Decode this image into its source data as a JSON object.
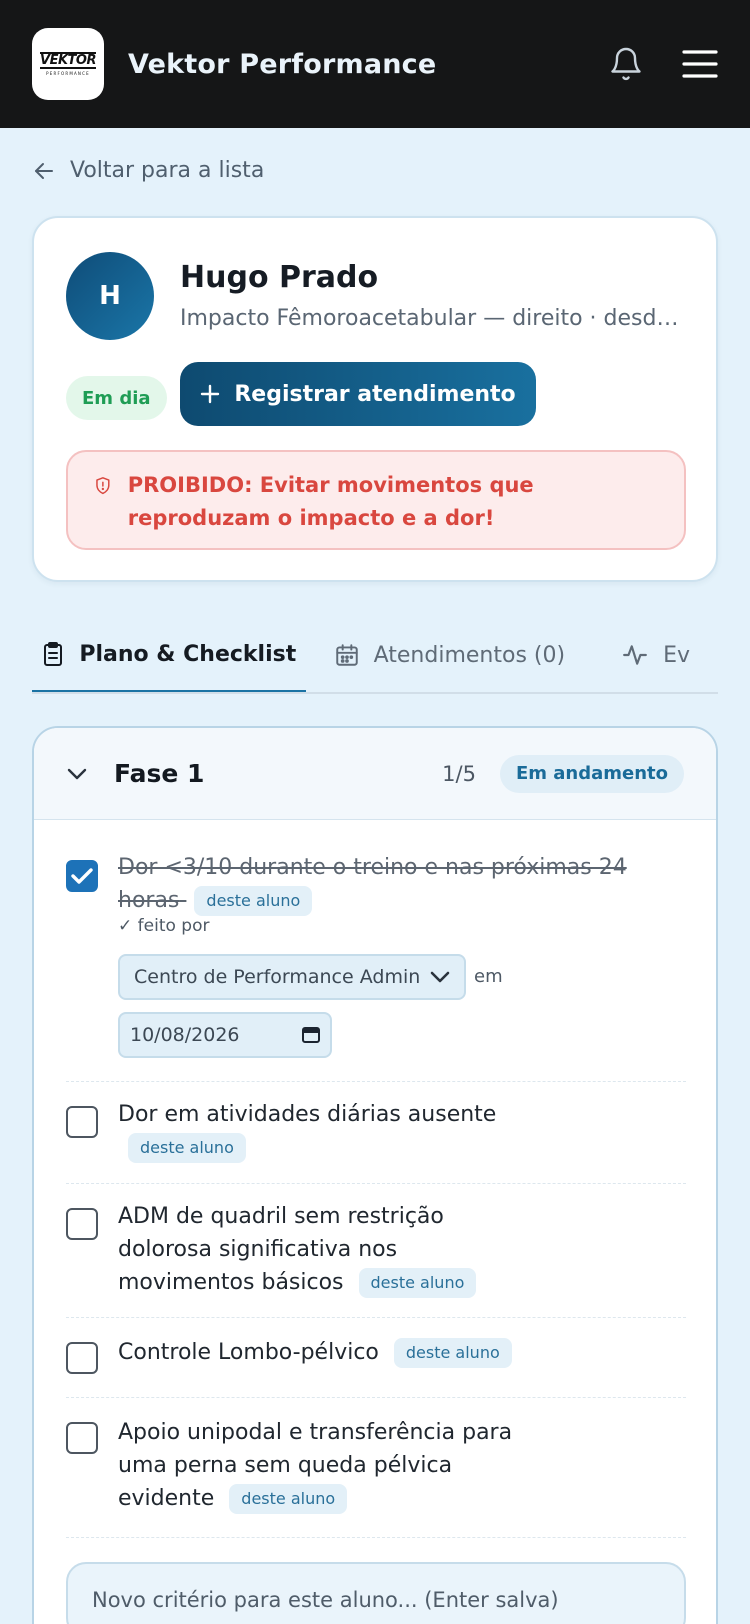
{
  "header": {
    "logo_text": "VEKTOR",
    "logo_subtext": "PERFORMANCE",
    "app_title": "Vektor Performance"
  },
  "back_link": "Voltar para a lista",
  "patient": {
    "initial": "H",
    "name": "Hugo Prado",
    "condition": "Impacto Fêmoroacetabular — direito · desde …",
    "status": "Em dia",
    "register_button": "Registrar atendimento",
    "alert": "PROIBIDO: Evitar movimentos que reproduzam o impacto e a dor!"
  },
  "tabs": [
    {
      "label": "Plano & Checklist",
      "active": true
    },
    {
      "label": "Atendimentos (0)",
      "active": false
    },
    {
      "label": "Ev",
      "active": false
    }
  ],
  "phase": {
    "title": "Fase 1",
    "count": "1/5",
    "badge": "Em andamento",
    "items": [
      {
        "text": "Dor <3/10 durante o treino e nas próximas 24 horas",
        "tag": "deste aluno",
        "checked": true
      },
      {
        "text": "Dor em atividades diárias ausente",
        "tag": "deste aluno",
        "checked": false
      },
      {
        "text": "ADM de quadril sem restrição dolorosa significativa nos movimentos básicos",
        "tag": "deste aluno",
        "checked": false
      },
      {
        "text": "Controle Lombo-pélvico",
        "tag": "deste aluno",
        "checked": false
      },
      {
        "text": "Apoio unipodal e transferência para uma perna sem queda pélvica evidente",
        "tag": "deste aluno",
        "checked": false
      }
    ],
    "done_by_label": "✓ feito por",
    "done_by_value": "Centro de Performance Admin",
    "at_label": "em",
    "date_value": "10/08/2026",
    "new_criterion_placeholder": "Novo critério para este aluno... (Enter salva)"
  },
  "colors": {
    "header_bg": "#151617",
    "page_bg": "#e4f2fb",
    "primary": "#0e4a70",
    "success": "#1f9d55",
    "danger": "#d9473f",
    "checkbox": "#1d72b8"
  }
}
